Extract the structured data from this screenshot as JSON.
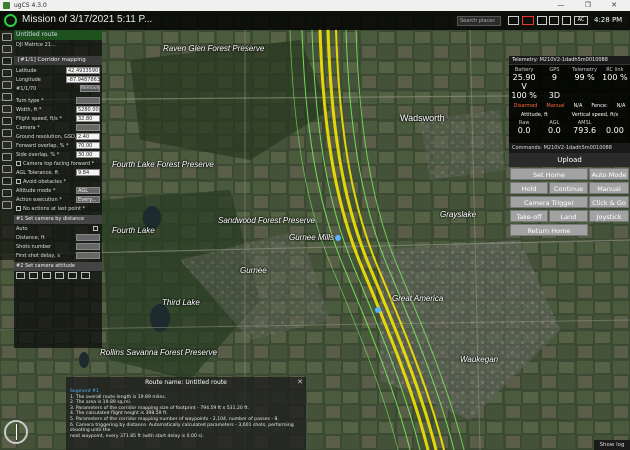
{
  "window": {
    "title": "ugCS 4.3.0",
    "controls": "—  ❐  ✕"
  },
  "header": {
    "mission_title": "Mission of 3/17/2021 5:11 P...",
    "search_placeholder": "Search places",
    "ac_label": "AC",
    "clock": "4:28 PM"
  },
  "route_list": {
    "route_name": "Untitled route",
    "vehicle": "DJI Matrice 21..."
  },
  "corridor": {
    "header": "[#1/1] Corridor mapping",
    "latitude_label": "Latitude",
    "latitude": "42.4933590",
    "longitude_label": "Longitude",
    "longitude": "-87.9487863",
    "point_label": "#1/1/70",
    "remove_label": "Remove",
    "fields": [
      {
        "label": "Turn type *",
        "value": ""
      },
      {
        "label": "Width, ft *",
        "value": "5280.00"
      },
      {
        "label": "Flight speed, ft/s *",
        "value": "32.80"
      },
      {
        "label": "Camera *",
        "value": ""
      },
      {
        "label": "Ground resolution, GSD, in/ft *",
        "value": "2.40"
      },
      {
        "label": "Forward overlap, % *",
        "value": "70.00"
      },
      {
        "label": "Side overlap, % *",
        "value": "30.00"
      },
      {
        "label": "Camera top facing forward *",
        "value": ""
      },
      {
        "label": "AGL Tolerance, ft",
        "value": "9.84"
      },
      {
        "label": "Avoid obstacles *",
        "value": ""
      },
      {
        "label": "Altitude mode *",
        "value": "AGL"
      },
      {
        "label": "Action execution *",
        "value": "Every..."
      },
      {
        "label": "No actions at last point *",
        "value": ""
      }
    ],
    "camera_by_distance": {
      "header": "#1 Set camera by distance",
      "fields": [
        {
          "label": "Auto",
          "value": ""
        },
        {
          "label": "Distance, ft",
          "value": ""
        },
        {
          "label": "Shots number",
          "value": ""
        },
        {
          "label": "First shot delay, s",
          "value": ""
        }
      ]
    },
    "camera_attitude": {
      "header": "#2 Set camera attitude"
    }
  },
  "telemetry": {
    "title": "Telemetry: M210V2-1dadh5m0010088",
    "columns": [
      "Battery",
      "GPS",
      "Telemetry",
      "RC link"
    ],
    "row1": [
      "25.90 V",
      "9",
      "99 %",
      "100 %"
    ],
    "row2": [
      "100 %",
      "3D",
      "",
      ""
    ],
    "status": {
      "disarmed": "Disarmed",
      "manual": "Manual",
      "na": "N/A",
      "fence_label": "Fence:",
      "fence": "N/A"
    },
    "attitude_header": "Attitude, ft",
    "vspeed_label": "Vertical speed, ft/s",
    "att_cols": [
      "Raw",
      "AGL",
      "AMSL",
      ""
    ],
    "att_vals": [
      "0.0",
      "0.0",
      "793.6",
      "0.00"
    ]
  },
  "commands": {
    "title": "Commands: M210V2-1dadh5m0010088",
    "upload": "Upload",
    "buttons": [
      [
        "Set Home",
        "Auto Mode"
      ],
      [
        "Hold",
        "Continue",
        "Manual Mode"
      ],
      [
        "Camera Trigger",
        "Click & Go"
      ],
      [
        "Take-off",
        "Land",
        "Joystick"
      ],
      [
        "Return Home"
      ]
    ]
  },
  "route_panel": {
    "title": "Route name: Untitled route",
    "segment": "Segment #1",
    "lines": [
      "1. The overall route length is 19.89 miles.",
      "2. The area is 19.89 sq.mi.",
      "3. Parameters of the corridor mapping size of footprint - 794.59 ft x 531.20 ft.",
      "4. The calculated flight height is 398.59 ft.",
      "5. Parameters of the corridor mapping number of waypoints - 2,104, number of passes - 8.",
      "6. Camera triggering by distance. Automatically calculated parameters - 3,601 shots, performing shooting until the",
      "next waypoint, every 371.85 ft (with start delay is 0.00 s)."
    ]
  },
  "map_labels": [
    {
      "text": "Raven Glen Forest Preserve"
    },
    {
      "text": "Wadsworth"
    },
    {
      "text": "Fourth Lake Forest Preserve"
    },
    {
      "text": "Fourth Lake"
    },
    {
      "text": "Gurnee Mills"
    },
    {
      "text": "Sandwood Forest Preserve"
    },
    {
      "text": "Third Lake"
    },
    {
      "text": "Rollins Savanna Forest Preserve"
    },
    {
      "text": "Great America"
    },
    {
      "text": "Gurnee"
    },
    {
      "text": "Grayslake"
    },
    {
      "text": "Waukegan"
    }
  ],
  "show_log": "Show log",
  "colors": {
    "route_yellow": "#f5e400",
    "route_green": "#7be85b",
    "accent_green": "#2ecc40"
  }
}
